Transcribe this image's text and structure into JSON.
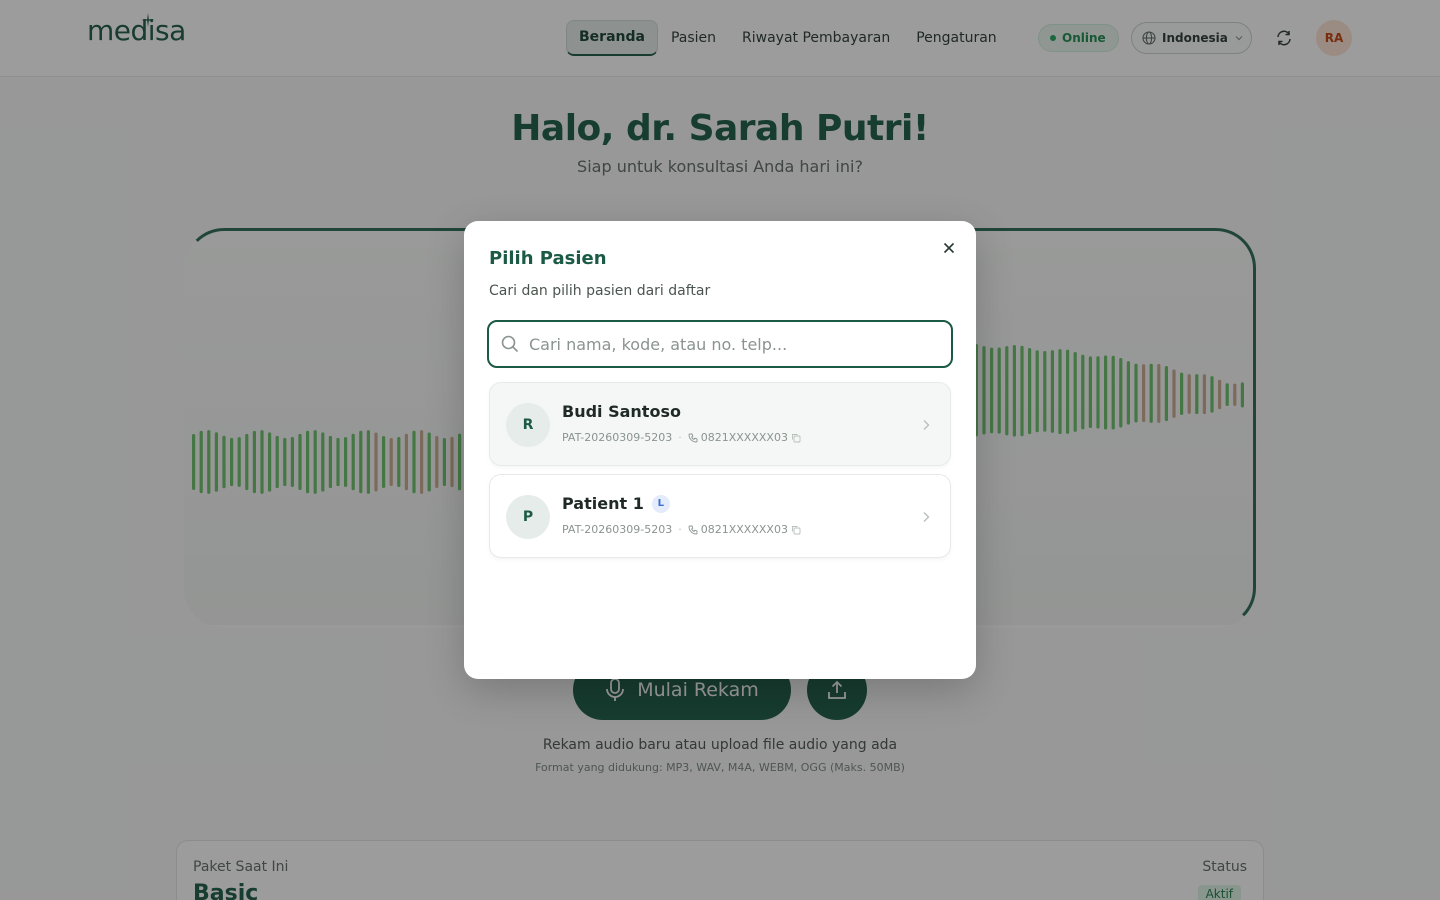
{
  "header": {
    "logo_text": "medisa",
    "nav": [
      {
        "label": "Beranda",
        "active": true
      },
      {
        "label": "Pasien",
        "active": false
      },
      {
        "label": "Riwayat Pembayaran",
        "active": false
      },
      {
        "label": "Pengaturan",
        "active": false
      }
    ],
    "status_label": "Online",
    "language": "Indonesia",
    "avatar_initials": "RA"
  },
  "main": {
    "greeting": "Halo, dr. Sarah Putri!",
    "subtitle": "Siap untuk konsultasi Anda hari ini?",
    "record_button": "Mulai Rekam",
    "hint": "Rekam audio baru atau upload file audio yang ada",
    "formats": "Format yang didukung: MP3, WAV, M4A, WEBM, OGG (Maks. 50MB)"
  },
  "plan": {
    "label": "Paket Saat Ini",
    "name": "Basic",
    "status_label": "Status",
    "status": "Aktif"
  },
  "modal": {
    "title": "Pilih Pasien",
    "description": "Cari dan pilih pasien dari daftar",
    "search_placeholder": "Cari nama, kode, atau no. telp...",
    "search_value": "",
    "patients": [
      {
        "initial": "R",
        "name": "Budi Santoso",
        "badge": "",
        "code": "PAT-20260309-5203",
        "phone": "0821XXXXXX03"
      },
      {
        "initial": "P",
        "name": "Patient 1",
        "badge": "L",
        "code": "PAT-20260309-5203",
        "phone": "0821XXXXXX03"
      }
    ]
  },
  "colors": {
    "brand": "#1b5a45",
    "online": "#22a45d",
    "avatar_bg": "#fbe3d3",
    "wave_green": "#6abf6a",
    "wave_tan": "#c8a98e"
  }
}
